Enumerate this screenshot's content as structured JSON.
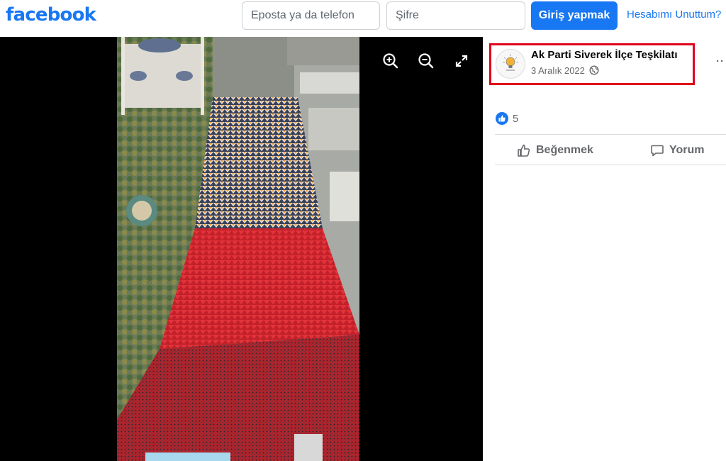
{
  "header": {
    "logo": "facebook",
    "email_placeholder": "Eposta ya da telefon",
    "password_placeholder": "Şifre",
    "login_label": "Giriş yapmak",
    "forgot_link": "Hesabımı Unuttum?"
  },
  "media": {
    "icons": [
      "zoom-in-icon",
      "zoom-out-icon",
      "expand-icon"
    ]
  },
  "post": {
    "page_name": "Ak Parti Siverek İlçe Teşkilatı",
    "date": "3 Aralık 2022",
    "privacy_icon": "globe-icon",
    "reaction_count": "5",
    "like_label": "Beğenmek",
    "comment_label": "Yorum"
  },
  "colors": {
    "brand": "#1877f2",
    "highlight": "#e0001b",
    "crowd_red": "#d4252b"
  }
}
